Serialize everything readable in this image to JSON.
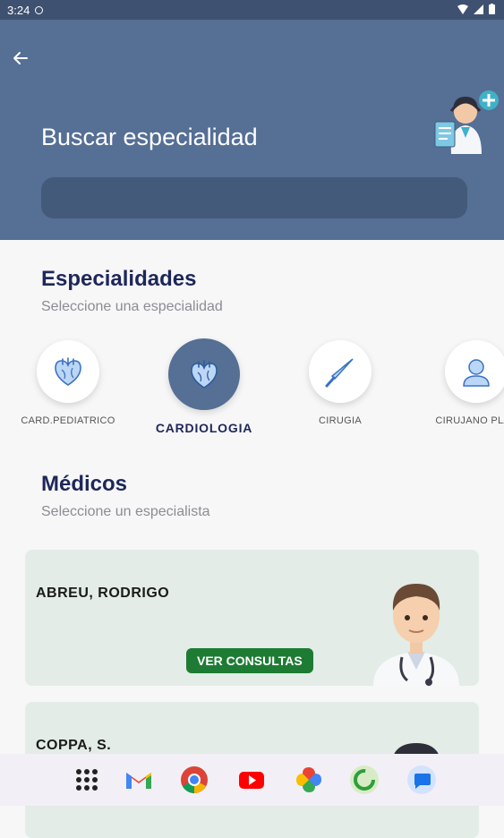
{
  "status_bar": {
    "time": "3:24"
  },
  "header": {
    "title": "Buscar especialidad",
    "search_placeholder": ""
  },
  "specialties_section": {
    "title": "Especialidades",
    "subtitle": "Seleccione una especialidad"
  },
  "specialties": [
    {
      "label": "CARD.PEDIATRICO",
      "icon": "heart-icon",
      "selected": false
    },
    {
      "label": "CARDIOLOGIA",
      "icon": "heart-icon",
      "selected": true
    },
    {
      "label": "CIRUGIA",
      "icon": "scalpel-icon",
      "selected": false
    },
    {
      "label": "CIRUJANO PLAS",
      "icon": "person-icon",
      "selected": false
    }
  ],
  "doctors_section": {
    "title": "Médicos",
    "subtitle": "Seleccione un especialista"
  },
  "doctors": [
    {
      "name": "ABREU, RODRIGO",
      "button_label": "VER CONSULTAS"
    },
    {
      "name": "COPPA, S."
    }
  ],
  "colors": {
    "header_bg": "#556f95",
    "status_bar_bg": "#3f5170",
    "card_bg": "#e3ece6",
    "button_green": "#1e7b34",
    "heading_navy": "#1e2759"
  },
  "taskbar_apps": [
    "apps-grid-icon",
    "gmail-icon",
    "chrome-icon",
    "youtube-icon",
    "photos-icon",
    "app-ring-icon",
    "messages-icon"
  ]
}
